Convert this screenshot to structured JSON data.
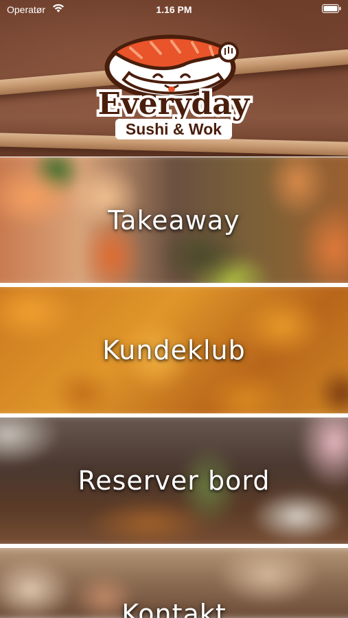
{
  "status_bar": {
    "carrier": "Operatør",
    "time": "1.16 PM",
    "icons": [
      "wifi-icon",
      "battery-icon"
    ]
  },
  "logo": {
    "line1": "Everyday",
    "line2": "Sushi & Wok"
  },
  "menu": {
    "items": [
      {
        "label": "Takeaway"
      },
      {
        "label": "Kundeklub"
      },
      {
        "label": "Reserver bord"
      },
      {
        "label": "Kontakt"
      }
    ]
  },
  "colors": {
    "logo_brown": "#4a1e0c",
    "salmon": "#e9542a",
    "label_text": "#ffffff"
  }
}
